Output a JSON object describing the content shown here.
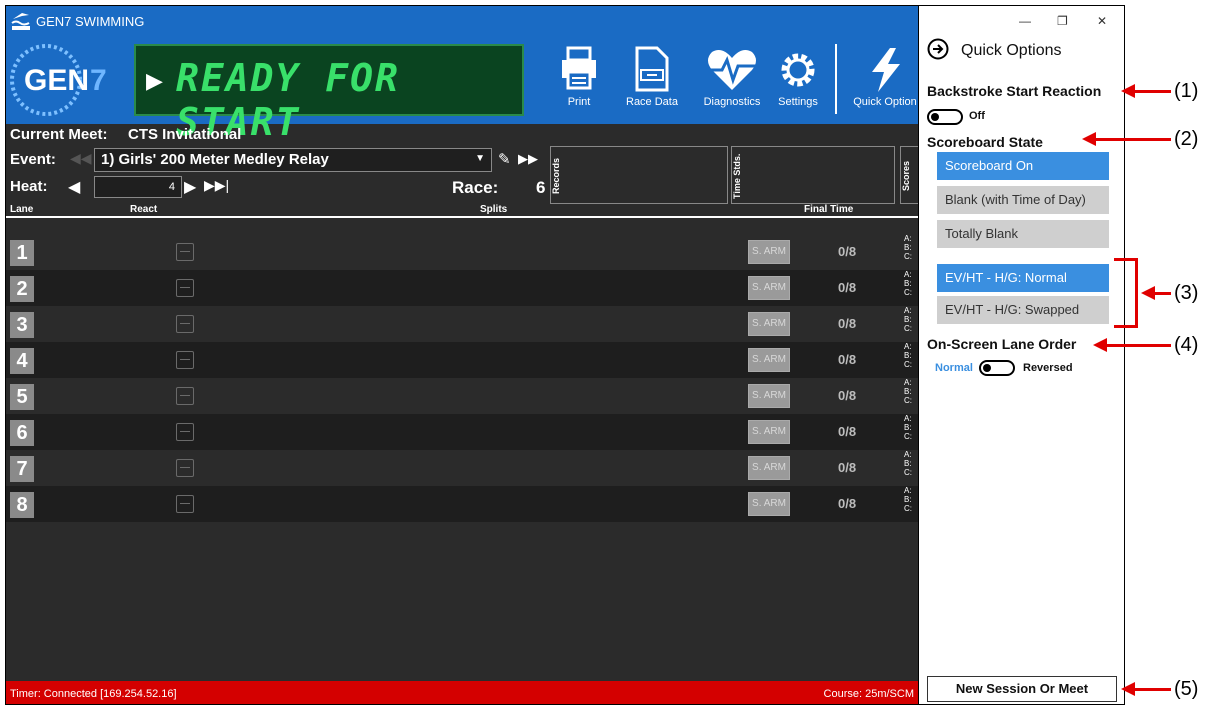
{
  "app": {
    "title": "GEN7 SWIMMING"
  },
  "scoreboard_text": "READY FOR START",
  "toolbar": [
    {
      "label": "Print"
    },
    {
      "label": "Race Data"
    },
    {
      "label": "Diagnostics"
    },
    {
      "label": "Settings"
    },
    {
      "label": "Quick Option"
    }
  ],
  "meet": {
    "label": "Current Meet:",
    "name": "CTS Invitational"
  },
  "event": {
    "label": "Event:",
    "value": "1) Girls' 200 Meter Medley Relay"
  },
  "heat": {
    "label": "Heat:",
    "value": "4"
  },
  "race": {
    "label": "Race:",
    "value": "6"
  },
  "boxes": {
    "records": "Records",
    "time_stds": "Time Stds.",
    "scores": "Scores"
  },
  "columns": {
    "lane": "Lane",
    "react": "React",
    "splits": "Splits",
    "final_time": "Final Time"
  },
  "lanes": [
    {
      "num": "1",
      "arm": "S. ARM",
      "count": "0/8"
    },
    {
      "num": "2",
      "arm": "S. ARM",
      "count": "0/8"
    },
    {
      "num": "3",
      "arm": "S. ARM",
      "count": "0/8"
    },
    {
      "num": "4",
      "arm": "S. ARM",
      "count": "0/8"
    },
    {
      "num": "5",
      "arm": "S. ARM",
      "count": "0/8"
    },
    {
      "num": "6",
      "arm": "S. ARM",
      "count": "0/8"
    },
    {
      "num": "7",
      "arm": "S. ARM",
      "count": "0/8"
    },
    {
      "num": "8",
      "arm": "S. ARM",
      "count": "0/8"
    }
  ],
  "abc": {
    "a": "A:",
    "b": "B:",
    "c": "C:"
  },
  "status": {
    "timer": "Timer: Connected [169.254.52.16]",
    "course": "Course: 25m/SCM"
  },
  "quick_options": {
    "title": "Quick Options",
    "backstroke": {
      "title": "Backstroke Start Reaction",
      "state": "Off"
    },
    "scoreboard_state": {
      "title": "Scoreboard State",
      "options": [
        "Scoreboard On",
        "Blank (with Time of Day)",
        "Totally Blank"
      ],
      "selected": "Scoreboard On"
    },
    "evht": {
      "options": [
        "EV/HT - H/G: Normal",
        "EV/HT - H/G: Swapped"
      ],
      "selected": "EV/HT - H/G: Normal"
    },
    "lane_order": {
      "title": "On-Screen Lane Order",
      "left": "Normal",
      "right": "Reversed"
    },
    "new_session": "New Session Or Meet"
  },
  "callouts": [
    "(1)",
    "(2)",
    "(3)",
    "(4)",
    "(5)"
  ],
  "colors": {
    "accent": "#1a6bc4",
    "status_bar": "#d40000",
    "led_green": "#39e06a",
    "callout_red": "#e00000",
    "option_active": "#3a8fe0"
  }
}
